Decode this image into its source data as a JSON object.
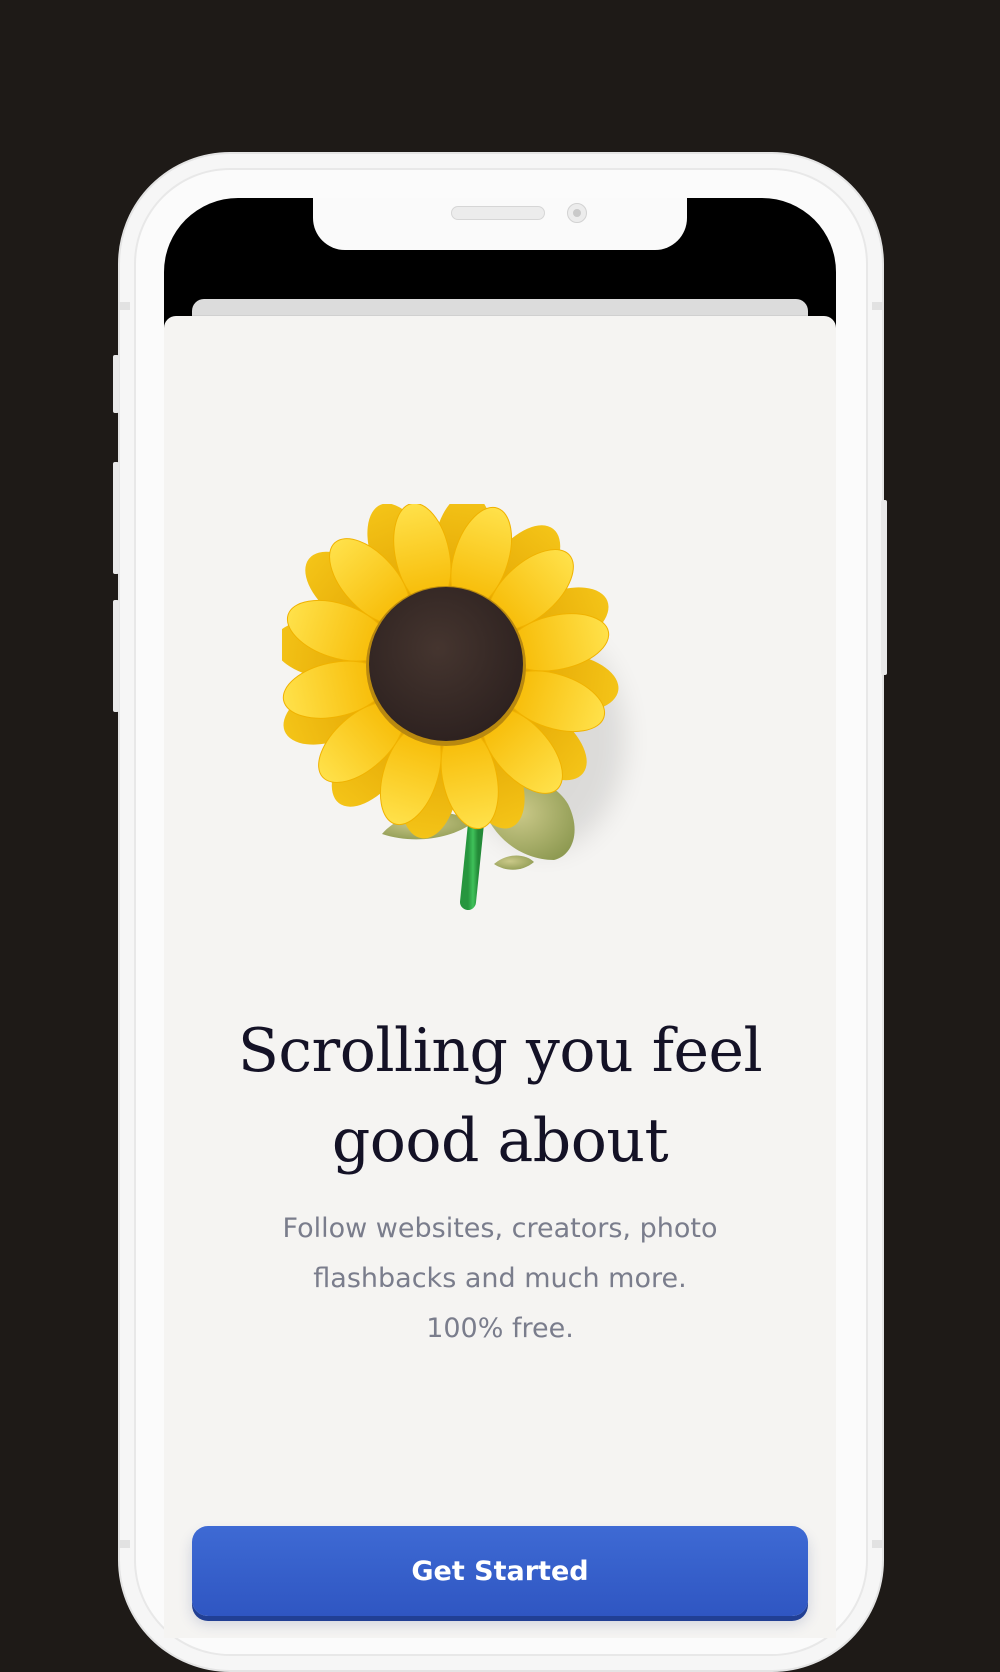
{
  "onboarding": {
    "headline_line1": "Scrolling you feel",
    "headline_line2": "good about",
    "subtitle_line1": "Follow websites, creators, photo",
    "subtitle_line2": "flashbacks and much more.",
    "subtitle_line3": "100% free.",
    "cta_label": "Get Started"
  },
  "illustration": {
    "icon": "sunflower-icon"
  },
  "colors": {
    "background": "#1e1a17",
    "sheet": "#f5f4f2",
    "headline": "#141226",
    "subtitle": "#7a7d8c",
    "button": "#3560c8",
    "petal": "#fcd116",
    "center": "#3a2c28",
    "stem": "#2eaa4a"
  }
}
